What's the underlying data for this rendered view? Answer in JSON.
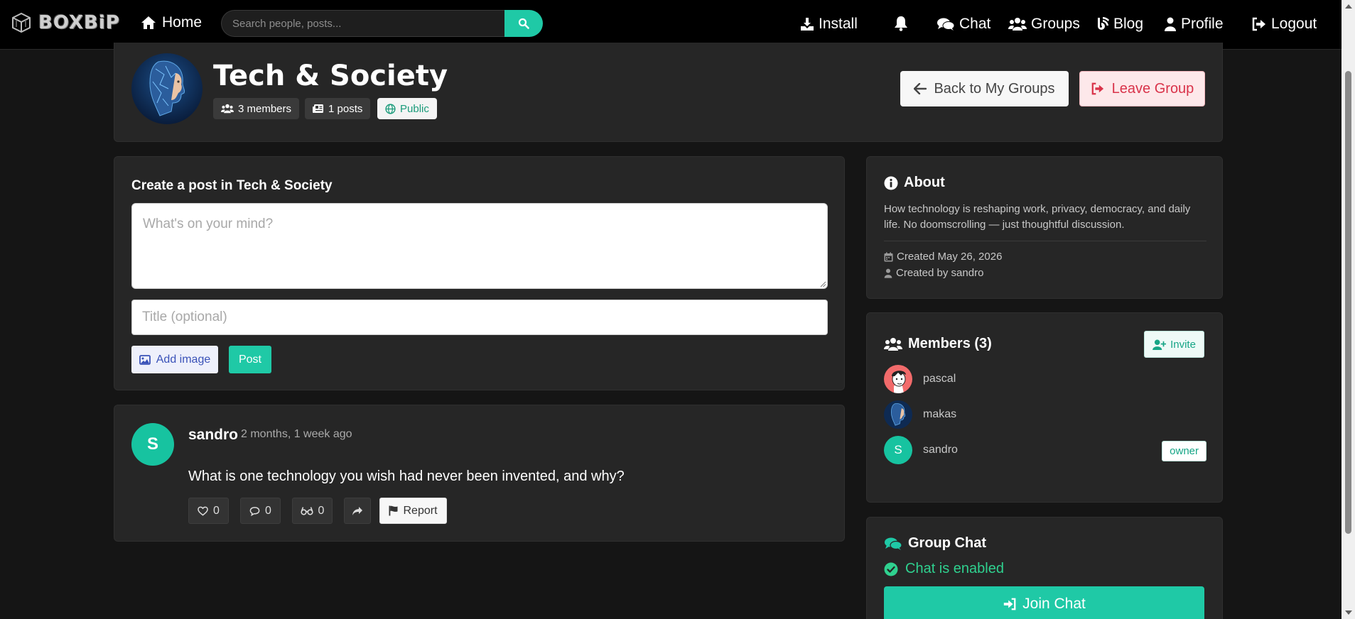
{
  "nav": {
    "brand": "BOXBiP",
    "home": "Home",
    "search_placeholder": "Search people, posts...",
    "install": "Install",
    "chat": "Chat",
    "groups": "Groups",
    "blog": "Blog",
    "profile": "Profile",
    "logout": "Logout"
  },
  "group": {
    "title": "Tech & Society",
    "members_chip": "3 members",
    "posts_chip": "1 posts",
    "visibility_chip": "Public",
    "back_label": "Back to My Groups",
    "leave_label": "Leave Group"
  },
  "composer": {
    "title": "Create a post in Tech & Society",
    "body_placeholder": "What's on your mind?",
    "title_placeholder": "Title (optional)",
    "add_image_label": "Add image",
    "post_label": "Post"
  },
  "post": {
    "avatar_letter": "S",
    "author": "sandro",
    "time": "2 months, 1 week ago",
    "text": "What is one technology you wish had never been invented, and why?",
    "likes": "0",
    "comments": "0",
    "views": "0",
    "report_label": "Report"
  },
  "about": {
    "title": "About",
    "description": "How technology is reshaping work, privacy, democracy, and daily life. No doomscrolling — just thoughtful discussion.",
    "created": "Created May 26, 2026",
    "created_by": "Created by sandro"
  },
  "members": {
    "title": "Members (3)",
    "invite_label": "Invite",
    "list": [
      {
        "name": "pascal"
      },
      {
        "name": "makas"
      },
      {
        "name": "sandro",
        "initial": "S",
        "badge": "owner"
      }
    ]
  },
  "group_chat": {
    "title": "Group Chat",
    "status": "Chat is enabled",
    "join_label": "Join Chat"
  },
  "colors": {
    "accent": "#1fc9a6",
    "danger": "#d9334a",
    "background": "#151515",
    "card": "#262626"
  }
}
